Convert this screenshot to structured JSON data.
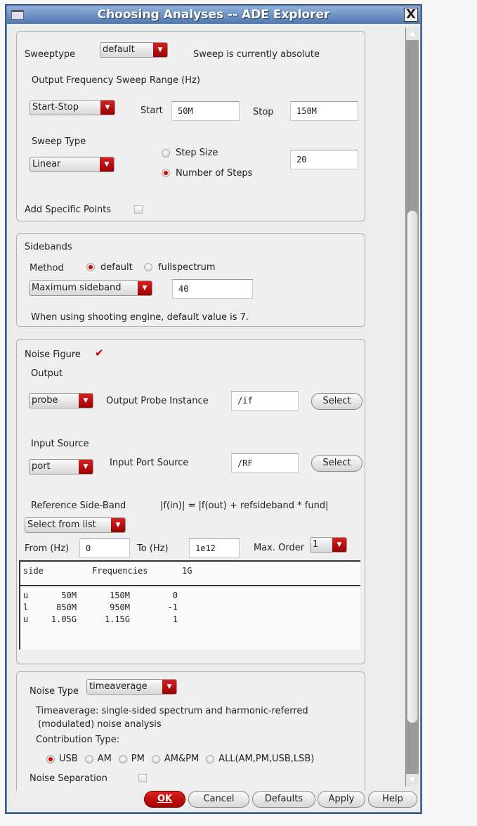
{
  "window": {
    "title": "Choosing Analyses -- ADE Explorer",
    "close": "X"
  },
  "sweep": {
    "sweeptype_label": "Sweeptype",
    "sweeptype_value": "default",
    "status": "Sweep is currently absolute",
    "range_label": "Output Frequency Sweep Range (Hz)",
    "range_mode": "Start-Stop",
    "start_label": "Start",
    "start_value": "50M",
    "stop_label": "Stop",
    "stop_value": "150M",
    "sweep_type_label": "Sweep Type",
    "sweep_type_value": "Linear",
    "step_size_label": "Step Size",
    "num_steps_label": "Number of Steps",
    "steps_value": "20",
    "add_points_label": "Add Specific Points"
  },
  "sidebands": {
    "title": "Sidebands",
    "method_label": "Method",
    "opt_default": "default",
    "opt_full": "fullspectrum",
    "mode": "Maximum sideband",
    "value": "40",
    "note": "When using shooting engine, default value is 7."
  },
  "noise": {
    "nf_label": "Noise Figure",
    "output_label": "Output",
    "output_value": "probe",
    "probe_label": "Output Probe Instance",
    "probe_value": "/if",
    "select": "Select",
    "input_label": "Input Source",
    "input_value": "port",
    "port_label": "Input Port Source",
    "port_value": "/RF",
    "ref_label": "Reference Side-Band",
    "formula": "|f(in)| = |f(out) + refsideband * fund|",
    "ref_mode": "Select from list",
    "from_label": "From (Hz)",
    "from_value": "0",
    "to_label": "To (Hz)",
    "to_value": "1e12",
    "maxorder_label": "Max. Order",
    "maxorder_value": "1",
    "table_header": [
      "side",
      "Frequencies",
      "1G"
    ],
    "rows": [
      [
        "u",
        "50M",
        "150M",
        "0"
      ],
      [
        "l",
        "850M",
        "950M",
        "-1"
      ],
      [
        "u",
        "1.05G",
        "1.15G",
        "1"
      ]
    ]
  },
  "noisetype": {
    "label": "Noise Type",
    "value": "timeaverage",
    "desc1": "Timeaverage: single-sided spectrum and harmonic-referred",
    "desc2": "(modulated) noise analysis",
    "contrib_label": "Contribution Type:",
    "options": [
      "USB",
      "AM",
      "PM",
      "AM&PM",
      "ALL(AM,PM,USB,LSB)"
    ],
    "separation_label": "Noise Separation"
  },
  "buttons": {
    "ok": "OK",
    "cancel": "Cancel",
    "defaults": "Defaults",
    "apply": "Apply",
    "help": "Help"
  }
}
